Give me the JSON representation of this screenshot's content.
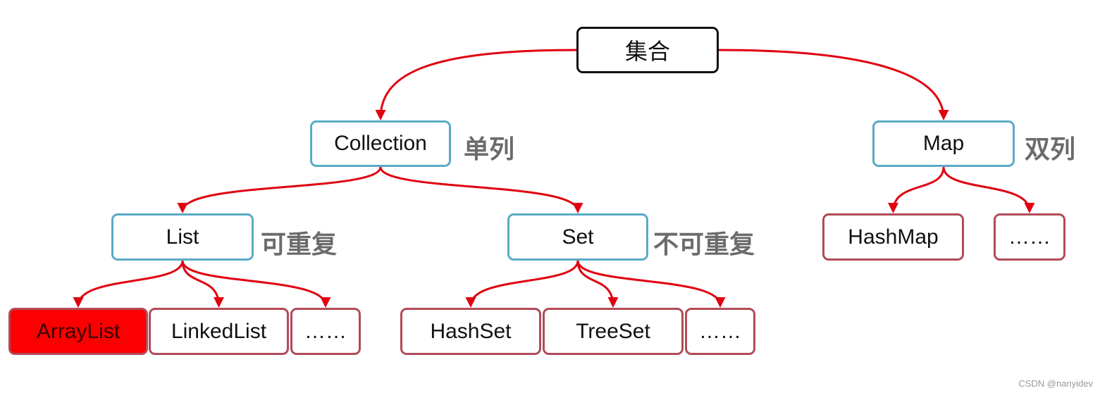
{
  "nodes": {
    "root": "集合",
    "collection": "Collection",
    "map": "Map",
    "list": "List",
    "set": "Set",
    "hashmap": "HashMap",
    "map_more": "……",
    "arraylist": "ArrayList",
    "linkedlist": "LinkedList",
    "list_more": "……",
    "hashset": "HashSet",
    "treeset": "TreeSet",
    "set_more": "……"
  },
  "tags": {
    "collection": "单列",
    "map": "双列",
    "list": "可重复",
    "set": "不可重复"
  },
  "edges": [
    [
      "root",
      "collection"
    ],
    [
      "root",
      "map"
    ],
    [
      "collection",
      "list"
    ],
    [
      "collection",
      "set"
    ],
    [
      "map",
      "hashmap"
    ],
    [
      "map",
      "map_more"
    ],
    [
      "list",
      "arraylist"
    ],
    [
      "list",
      "linkedlist"
    ],
    [
      "list",
      "list_more"
    ],
    [
      "set",
      "hashset"
    ],
    [
      "set",
      "treeset"
    ],
    [
      "set",
      "set_more"
    ]
  ],
  "highlighted": "arraylist",
  "colors": {
    "arrow": "#e00010",
    "highlight": "#fa0000",
    "mid_border": "#5aaac8",
    "leaf_border": "#b24a58"
  },
  "watermark": "CSDN @nanyidev"
}
